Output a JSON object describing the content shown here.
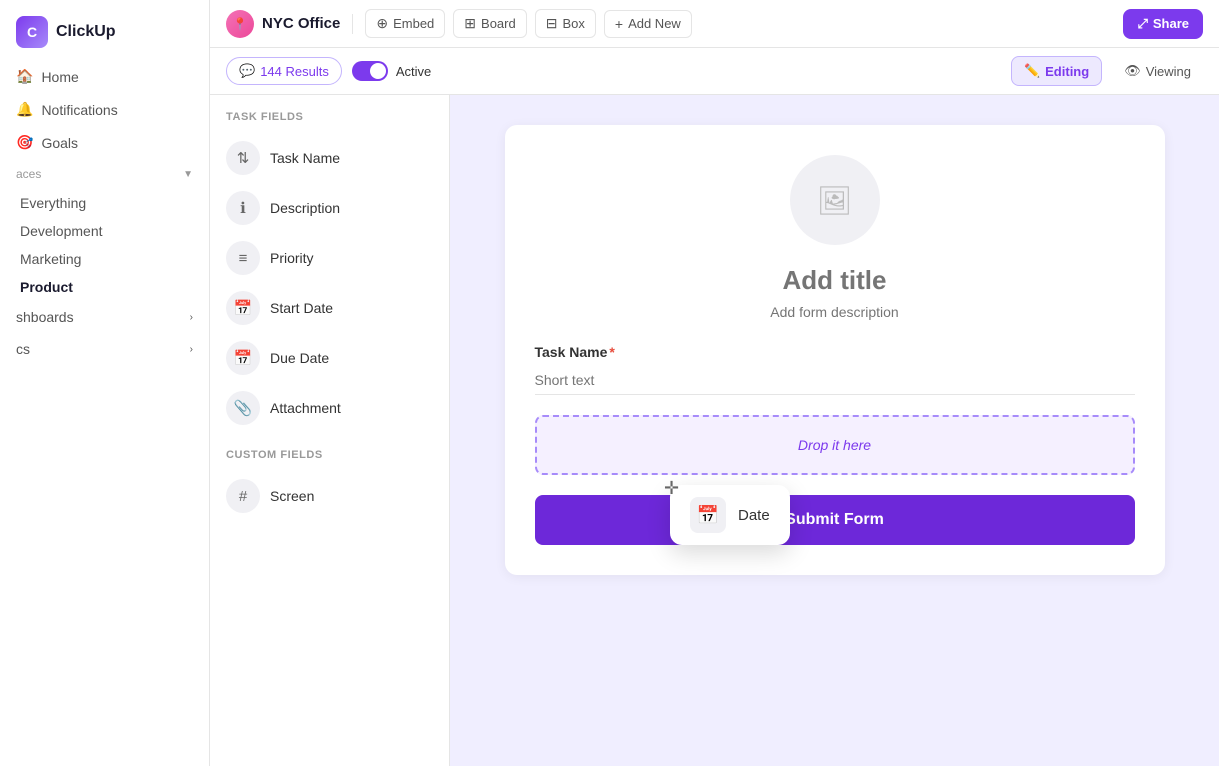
{
  "sidebar": {
    "logo": "ClickUp",
    "nav_items": [
      {
        "label": "Home",
        "icon": "🏠"
      },
      {
        "label": "Notifications",
        "icon": "🔔"
      },
      {
        "label": "Goals",
        "icon": "🎯"
      }
    ],
    "spaces_label": "aces",
    "space_items": [
      {
        "label": "Everything",
        "active": false
      },
      {
        "label": "Development",
        "active": false
      },
      {
        "label": "Marketing",
        "active": false
      },
      {
        "label": "Product",
        "active": true
      }
    ],
    "dashboards_label": "shboards",
    "docs_label": "cs"
  },
  "topbar": {
    "brand_icon": "📍",
    "brand_name": "NYC Office",
    "buttons": [
      {
        "label": "Embed",
        "icon": "⊕"
      },
      {
        "label": "Board",
        "icon": "⊞"
      },
      {
        "label": "Box",
        "icon": "⊟"
      },
      {
        "label": "Add New",
        "icon": "+"
      }
    ],
    "share_label": "Share"
  },
  "filterbar": {
    "results_count": "144 Results",
    "active_label": "Active",
    "editing_label": "Editing",
    "viewing_label": "Viewing"
  },
  "fields_panel": {
    "task_fields_title": "TASK FIELDS",
    "task_fields": [
      {
        "label": "Task Name",
        "icon": "⇅"
      },
      {
        "label": "Description",
        "icon": "ℹ"
      },
      {
        "label": "Priority",
        "icon": "≡"
      },
      {
        "label": "Start Date",
        "icon": "📅"
      },
      {
        "label": "Due Date",
        "icon": "📅"
      },
      {
        "label": "Attachment",
        "icon": "📎"
      }
    ],
    "custom_fields_title": "CUSTOM FIELDS",
    "custom_fields": [
      {
        "label": "Screen",
        "icon": "#"
      }
    ]
  },
  "form": {
    "title_placeholder": "Add title",
    "description_placeholder": "Add form description",
    "field_task_name": "Task Name",
    "field_task_name_required": true,
    "field_task_name_placeholder": "Short text",
    "drop_zone_text": "Drop it here",
    "submit_label": "Submit Form"
  },
  "floating_card": {
    "label": "Date",
    "icon": "📅"
  }
}
